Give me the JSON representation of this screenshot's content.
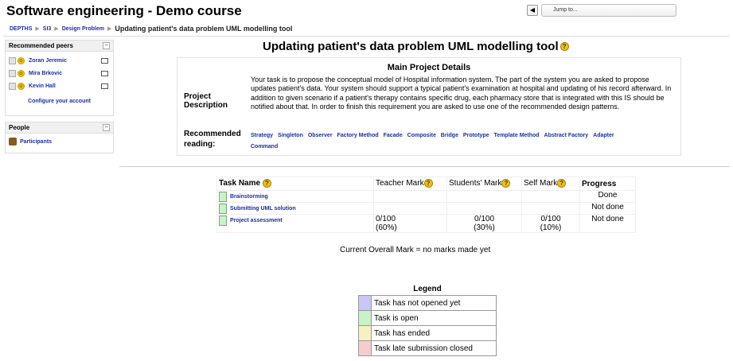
{
  "course_title": "Software engineering - Demo course",
  "jump": {
    "label": "Jump to..."
  },
  "nav": {
    "items": [
      "DEPTHS",
      "SI3",
      "Design Problem"
    ],
    "current": "Updating patient's data problem UML modelling tool"
  },
  "peers_block": {
    "title": "Recommended peers",
    "peers": [
      "Zoran Jeremic",
      "Mira Brkovic",
      "Kevin Hall"
    ],
    "configure": "Configure your account"
  },
  "people_block": {
    "title": "People",
    "participants": "Participants"
  },
  "page_title": "Updating patient's data problem UML modelling tool",
  "details": {
    "heading": "Main Project Details",
    "label_desc_1": "Project",
    "label_desc_2": "Description",
    "description": "Your task is to propose the conceptual model of Hospital information system. The part of the system you are asked to propose updates patient's data. Your system should support a typical patient's examination at hospital and updating of his record afterward. In addition to given scenario if a patient's therapy contains specific drug, each pharmacy store that is integrated with this IS should be notified about that. In order to finish this requirement you are asked to use one of the recommended design patterns.",
    "label_reading_1": "Recommended",
    "label_reading_2": "reading:",
    "reading": [
      "Strategy",
      "Singleton",
      "Observer",
      "Factory Method",
      "Facade",
      "Composite",
      "Bridge",
      "Prototype",
      "Template Method",
      "Abstract Factory",
      "Adapter",
      "Command"
    ]
  },
  "tasks": {
    "headers": {
      "name": "Task Name",
      "teacher": "Teacher Mark",
      "students": "Students' Mark",
      "self": "Self Mark",
      "progress": "Progress"
    },
    "rows": [
      {
        "name": "Brainstorming",
        "teacher": "",
        "teacher2": "",
        "students": "",
        "students2": "",
        "self": "",
        "self2": "",
        "progress": "Done"
      },
      {
        "name": "Submitting UML solution",
        "teacher": "",
        "teacher2": "",
        "students": "",
        "students2": "",
        "self": "",
        "self2": "",
        "progress": "Not done"
      },
      {
        "name": "Project assessment",
        "teacher": "0/100",
        "teacher2": "(60%)",
        "students": "0/100",
        "students2": "(30%)",
        "self": "0/100",
        "self2": "(10%)",
        "progress": "Not done"
      }
    ]
  },
  "overall": "Current Overall Mark = no marks made yet",
  "legend": {
    "title": "Legend",
    "items": [
      {
        "color": "#c8c8f4",
        "label": "Task has not opened yet"
      },
      {
        "color": "#c8f2c8",
        "label": "Task is open"
      },
      {
        "color": "#f6f2c0",
        "label": "Task has ended"
      },
      {
        "color": "#f6cccc",
        "label": "Task late submission closed"
      }
    ]
  },
  "colors": {
    "link": "#1a2ea6",
    "help": "#f4c20d"
  }
}
